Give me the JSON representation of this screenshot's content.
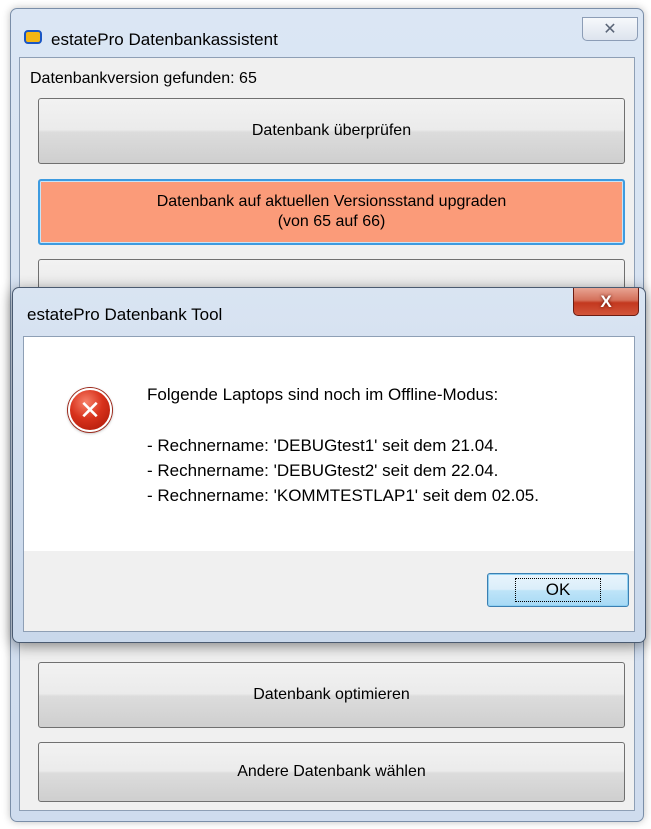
{
  "main_window": {
    "title": "estatePro Datenbankassistent",
    "close_glyph": "✕",
    "version_label": "Datenbankversion gefunden: 65",
    "buttons": {
      "check": "Datenbank überprüfen",
      "upgrade_line1": "Datenbank auf aktuellen Versionsstand upgraden",
      "upgrade_line2": "(von 65 auf 66)",
      "optimize": "Datenbank optimieren",
      "other_db": "Andere Datenbank wählen"
    },
    "accent_upgrade_color": "#fb9b79"
  },
  "dialog": {
    "title": "estatePro Datenbank Tool",
    "close_glyph": "X",
    "icon": "error-icon",
    "icon_glyph": "✕",
    "heading": "Folgende Laptops sind noch im Offline-Modus:",
    "lines": [
      "- Rechnername: 'DEBUGtest1' seit dem 21.04.",
      "- Rechnername: 'DEBUGtest2' seit dem 22.04.",
      "- Rechnername: 'KOMMTESTLAP1' seit dem 02.05."
    ],
    "ok_label": "OK"
  }
}
